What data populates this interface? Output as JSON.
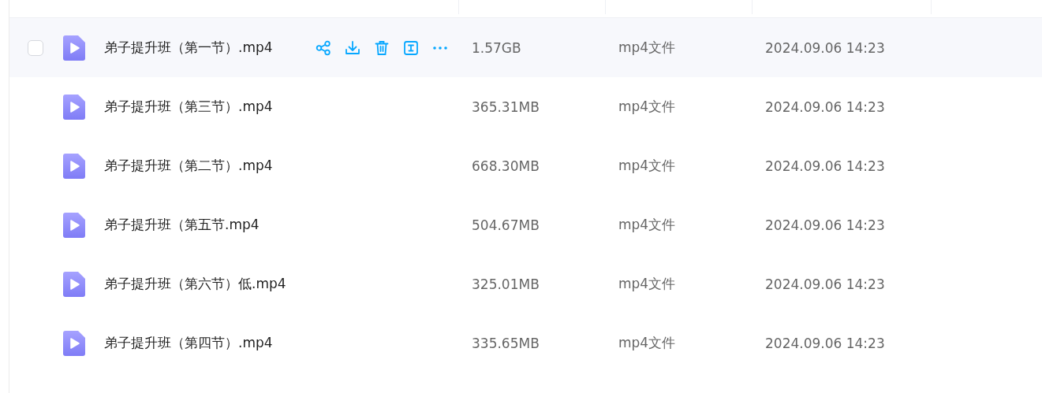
{
  "rows": [
    {
      "name": "弟子提升班（第一节）.mp4",
      "size": "1.57GB",
      "type": "mp4文件",
      "date": "2024.09.06 14:23",
      "hovered": true,
      "checked": false
    },
    {
      "name": "弟子提升班（第三节）.mp4",
      "size": "365.31MB",
      "type": "mp4文件",
      "date": "2024.09.06 14:23",
      "hovered": false
    },
    {
      "name": "弟子提升班（第二节）.mp4",
      "size": "668.30MB",
      "type": "mp4文件",
      "date": "2024.09.06 14:23",
      "hovered": false
    },
    {
      "name": "弟子提升班（第五节.mp4",
      "size": "504.67MB",
      "type": "mp4文件",
      "date": "2024.09.06 14:23",
      "hovered": false
    },
    {
      "name": "弟子提升班（第六节）低.mp4",
      "size": "325.01MB",
      "type": "mp4文件",
      "date": "2024.09.06 14:23",
      "hovered": false
    },
    {
      "name": "弟子提升班（第四节）.mp4",
      "size": "335.65MB",
      "type": "mp4文件",
      "date": "2024.09.06 14:23",
      "hovered": false
    }
  ]
}
